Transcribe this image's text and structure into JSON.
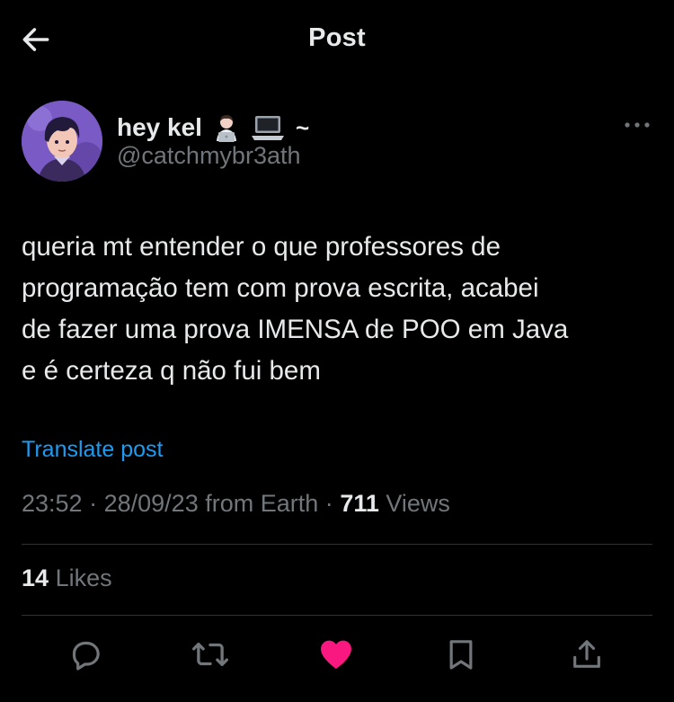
{
  "header": {
    "title": "Post",
    "back_icon": "arrow-left-icon"
  },
  "author": {
    "display_name": "hey kel",
    "emojis": [
      "person-at-laptop-emoji",
      "laptop-emoji"
    ],
    "name_suffix": "~",
    "handle": "@catchmybr3ath",
    "avatar": "avatar-illustration"
  },
  "post": {
    "text": "queria mt entender o que professores de\nprogramação tem com prova escrita, acabei\nde fazer uma prova IMENSA de POO em Java\ne é certeza q não fui bem",
    "translate_label": "Translate post",
    "time": "23:52",
    "date": "28/09/23",
    "source": "from Earth",
    "separator": "·",
    "views_count": "711",
    "views_label": "Views",
    "likes_count": "14",
    "likes_label": "Likes"
  },
  "actions": {
    "reply_icon": "reply-icon",
    "repost_icon": "repost-icon",
    "like_icon": "heart-icon",
    "bookmark_icon": "bookmark-icon",
    "share_icon": "share-icon"
  },
  "colors": {
    "background": "#000000",
    "text": "#e7e9ea",
    "secondary": "#71767b",
    "link": "#1d9bf0",
    "like": "#f91880",
    "divider": "#2f3336"
  }
}
